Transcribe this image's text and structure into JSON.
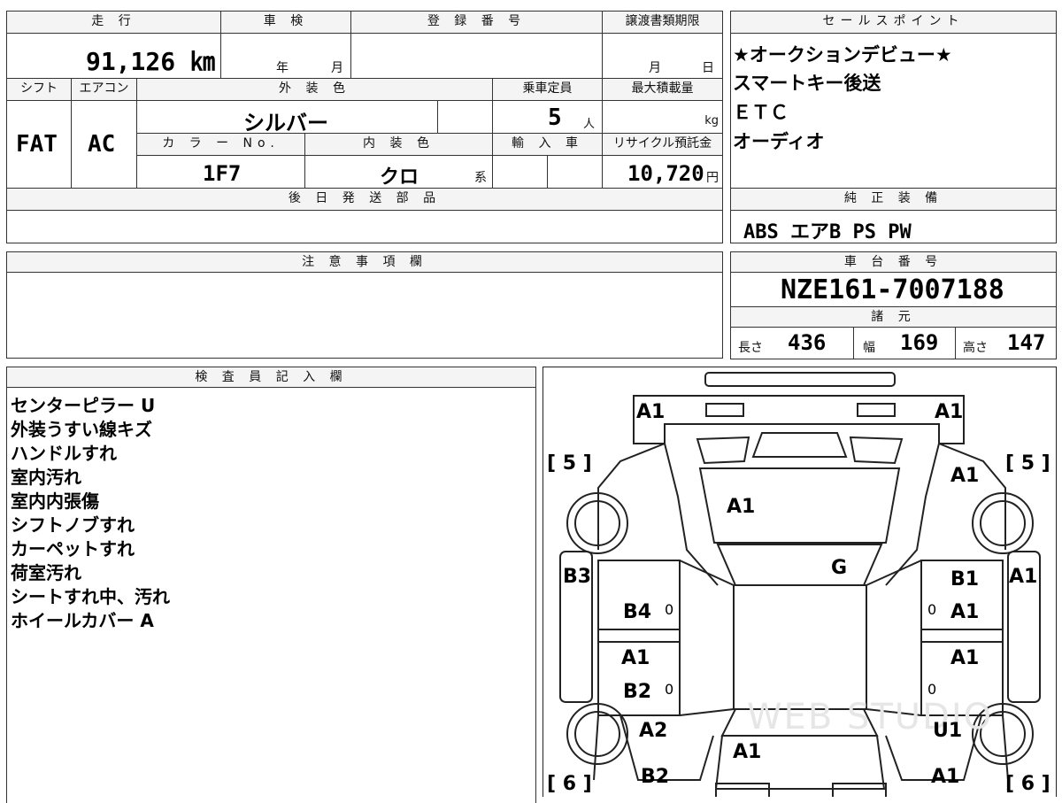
{
  "top": {
    "mileage_header": "走 行",
    "inspection_header": "車 検",
    "registration_header": "登 録 番 号",
    "transfer_deadline_header": "譲渡書類期限",
    "mileage_value": "91,126 ㎞",
    "inspection_year": "年",
    "inspection_month": "月",
    "deadline_month": "月",
    "deadline_day": "日"
  },
  "row2": {
    "shift_header": "シフト",
    "ac_header": "エアコン",
    "exterior_header": "外 装 色",
    "capacity_header": "乗車定員",
    "maxload_header": "最大積載量",
    "shift_value": "FAT",
    "ac_value": "AC",
    "exterior_value": "シルバー",
    "capacity_value": "5",
    "capacity_unit": "人",
    "maxload_unit": "kg",
    "color_no_header": "カ ラ ー No.",
    "interior_header": "内 装 色",
    "import_header": "輸 入 車",
    "recycle_header": "リサイクル預託金",
    "color_no_value": "1F7",
    "interior_value": "クロ",
    "interior_suffix": "系",
    "recycle_value": "10,720",
    "recycle_unit": "円"
  },
  "later_parts": {
    "header": "後 日 発 送 部 品",
    "value": ""
  },
  "notes": {
    "header": "注 意 事 項 欄",
    "value": ""
  },
  "sales_point": {
    "header": "セールスポイント",
    "items": [
      "★オークションデビュー★",
      "スマートキー後送",
      "ＥＴＣ",
      "オーディオ"
    ]
  },
  "genuine_equipment": {
    "header": "純 正 装 備",
    "value": "ABS エアB PS PW"
  },
  "chassis": {
    "header": "車 台 番 号",
    "value": "NZE161-7007188"
  },
  "specs": {
    "header": "諸 元",
    "length_label": "長さ",
    "length_value": "436",
    "width_label": "幅",
    "width_value": "169",
    "height_label": "高さ",
    "height_value": "147"
  },
  "inspector": {
    "header": "検 査 員 記 入 欄",
    "lines": [
      "センターピラー U",
      "外装うすい線キズ",
      "ハンドルすれ",
      "室内汚れ",
      "室内内張傷",
      "シフトノブすれ",
      "カーペットすれ",
      "荷室汚れ",
      "シートすれ中、汚れ",
      "ホイールカバー A"
    ]
  },
  "diagram": {
    "watermark": "WEB STUDIO",
    "marks": {
      "front_left": "A1",
      "front_right": "A1",
      "hood": "A1",
      "fender_front_right": "A1",
      "windshield": "G",
      "pillar_left": "B3",
      "pillar_right_outer": "A1",
      "front_door_left": "B4",
      "front_door_right_upper": "B1",
      "front_door_right_lower": "A1",
      "rear_door_left_upper": "A1",
      "rear_door_left_lower": "B2",
      "rear_door_right": "A1",
      "quarter_left": "A2",
      "quarter_right": "U1",
      "trunk": "A1",
      "rear_left": "B2",
      "rear_right": "A1",
      "tire_front_left": "[ 5 ]",
      "tire_front_right": "[ 5 ]",
      "tire_rear_left": "[ 6 ]",
      "tire_rear_right": "[ 6 ]",
      "zero_a": "0",
      "zero_b": "0",
      "zero_c": "0",
      "zero_d": "0"
    }
  }
}
